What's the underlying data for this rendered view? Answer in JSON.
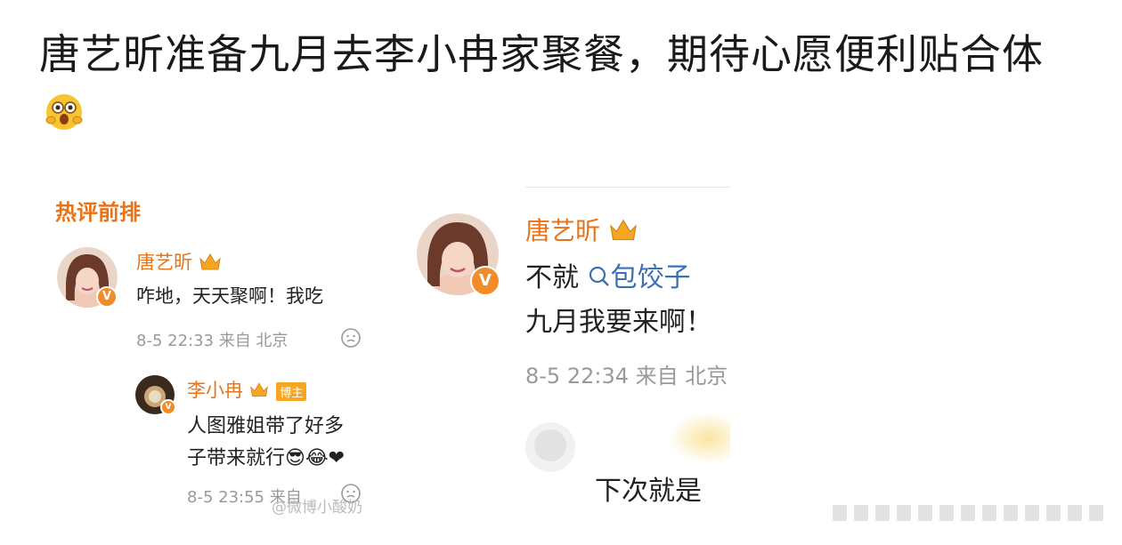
{
  "title": "唐艺昕准备九月去李小冉家聚餐，期待心愿便利贴合体",
  "left_screenshot": {
    "header": "热评前排",
    "comment": {
      "name": "唐艺昕",
      "text": "咋地，天天聚啊！我吃",
      "meta": "8-5 22:33  来自 北京"
    },
    "reply": {
      "name": "李小冉",
      "badge": "博主",
      "text_line1": "人图雅姐带了好多",
      "text_line2": "子带来就行",
      "emoji": "😎😂❤",
      "meta": "8-5 23:55  来自"
    }
  },
  "right_screenshot": {
    "comment": {
      "name": "唐艺昕",
      "text_prefix": "不就",
      "link_text": "包饺子",
      "text_line2": "九月我要来啊！",
      "meta": "8-5 22:34  来自 北京"
    },
    "next_reply": {
      "text": "下次就是"
    }
  },
  "watermark": "@微博小酸奶",
  "colors": {
    "accent": "#e8731a",
    "link": "#3b6fb6",
    "meta": "#999999"
  }
}
